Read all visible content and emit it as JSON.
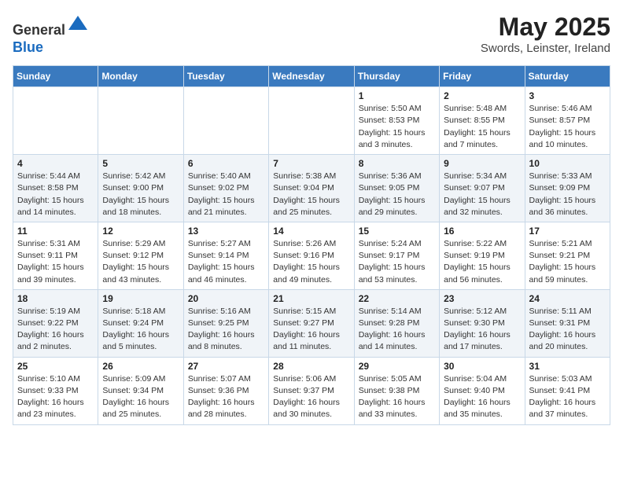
{
  "header": {
    "logo_general": "General",
    "logo_blue": "Blue",
    "month_year": "May 2025",
    "location": "Swords, Leinster, Ireland"
  },
  "weekdays": [
    "Sunday",
    "Monday",
    "Tuesday",
    "Wednesday",
    "Thursday",
    "Friday",
    "Saturday"
  ],
  "weeks": [
    [
      {
        "day": "",
        "info": ""
      },
      {
        "day": "",
        "info": ""
      },
      {
        "day": "",
        "info": ""
      },
      {
        "day": "",
        "info": ""
      },
      {
        "day": "1",
        "info": "Sunrise: 5:50 AM\nSunset: 8:53 PM\nDaylight: 15 hours\nand 3 minutes."
      },
      {
        "day": "2",
        "info": "Sunrise: 5:48 AM\nSunset: 8:55 PM\nDaylight: 15 hours\nand 7 minutes."
      },
      {
        "day": "3",
        "info": "Sunrise: 5:46 AM\nSunset: 8:57 PM\nDaylight: 15 hours\nand 10 minutes."
      }
    ],
    [
      {
        "day": "4",
        "info": "Sunrise: 5:44 AM\nSunset: 8:58 PM\nDaylight: 15 hours\nand 14 minutes."
      },
      {
        "day": "5",
        "info": "Sunrise: 5:42 AM\nSunset: 9:00 PM\nDaylight: 15 hours\nand 18 minutes."
      },
      {
        "day": "6",
        "info": "Sunrise: 5:40 AM\nSunset: 9:02 PM\nDaylight: 15 hours\nand 21 minutes."
      },
      {
        "day": "7",
        "info": "Sunrise: 5:38 AM\nSunset: 9:04 PM\nDaylight: 15 hours\nand 25 minutes."
      },
      {
        "day": "8",
        "info": "Sunrise: 5:36 AM\nSunset: 9:05 PM\nDaylight: 15 hours\nand 29 minutes."
      },
      {
        "day": "9",
        "info": "Sunrise: 5:34 AM\nSunset: 9:07 PM\nDaylight: 15 hours\nand 32 minutes."
      },
      {
        "day": "10",
        "info": "Sunrise: 5:33 AM\nSunset: 9:09 PM\nDaylight: 15 hours\nand 36 minutes."
      }
    ],
    [
      {
        "day": "11",
        "info": "Sunrise: 5:31 AM\nSunset: 9:11 PM\nDaylight: 15 hours\nand 39 minutes."
      },
      {
        "day": "12",
        "info": "Sunrise: 5:29 AM\nSunset: 9:12 PM\nDaylight: 15 hours\nand 43 minutes."
      },
      {
        "day": "13",
        "info": "Sunrise: 5:27 AM\nSunset: 9:14 PM\nDaylight: 15 hours\nand 46 minutes."
      },
      {
        "day": "14",
        "info": "Sunrise: 5:26 AM\nSunset: 9:16 PM\nDaylight: 15 hours\nand 49 minutes."
      },
      {
        "day": "15",
        "info": "Sunrise: 5:24 AM\nSunset: 9:17 PM\nDaylight: 15 hours\nand 53 minutes."
      },
      {
        "day": "16",
        "info": "Sunrise: 5:22 AM\nSunset: 9:19 PM\nDaylight: 15 hours\nand 56 minutes."
      },
      {
        "day": "17",
        "info": "Sunrise: 5:21 AM\nSunset: 9:21 PM\nDaylight: 15 hours\nand 59 minutes."
      }
    ],
    [
      {
        "day": "18",
        "info": "Sunrise: 5:19 AM\nSunset: 9:22 PM\nDaylight: 16 hours\nand 2 minutes."
      },
      {
        "day": "19",
        "info": "Sunrise: 5:18 AM\nSunset: 9:24 PM\nDaylight: 16 hours\nand 5 minutes."
      },
      {
        "day": "20",
        "info": "Sunrise: 5:16 AM\nSunset: 9:25 PM\nDaylight: 16 hours\nand 8 minutes."
      },
      {
        "day": "21",
        "info": "Sunrise: 5:15 AM\nSunset: 9:27 PM\nDaylight: 16 hours\nand 11 minutes."
      },
      {
        "day": "22",
        "info": "Sunrise: 5:14 AM\nSunset: 9:28 PM\nDaylight: 16 hours\nand 14 minutes."
      },
      {
        "day": "23",
        "info": "Sunrise: 5:12 AM\nSunset: 9:30 PM\nDaylight: 16 hours\nand 17 minutes."
      },
      {
        "day": "24",
        "info": "Sunrise: 5:11 AM\nSunset: 9:31 PM\nDaylight: 16 hours\nand 20 minutes."
      }
    ],
    [
      {
        "day": "25",
        "info": "Sunrise: 5:10 AM\nSunset: 9:33 PM\nDaylight: 16 hours\nand 23 minutes."
      },
      {
        "day": "26",
        "info": "Sunrise: 5:09 AM\nSunset: 9:34 PM\nDaylight: 16 hours\nand 25 minutes."
      },
      {
        "day": "27",
        "info": "Sunrise: 5:07 AM\nSunset: 9:36 PM\nDaylight: 16 hours\nand 28 minutes."
      },
      {
        "day": "28",
        "info": "Sunrise: 5:06 AM\nSunset: 9:37 PM\nDaylight: 16 hours\nand 30 minutes."
      },
      {
        "day": "29",
        "info": "Sunrise: 5:05 AM\nSunset: 9:38 PM\nDaylight: 16 hours\nand 33 minutes."
      },
      {
        "day": "30",
        "info": "Sunrise: 5:04 AM\nSunset: 9:40 PM\nDaylight: 16 hours\nand 35 minutes."
      },
      {
        "day": "31",
        "info": "Sunrise: 5:03 AM\nSunset: 9:41 PM\nDaylight: 16 hours\nand 37 minutes."
      }
    ]
  ]
}
